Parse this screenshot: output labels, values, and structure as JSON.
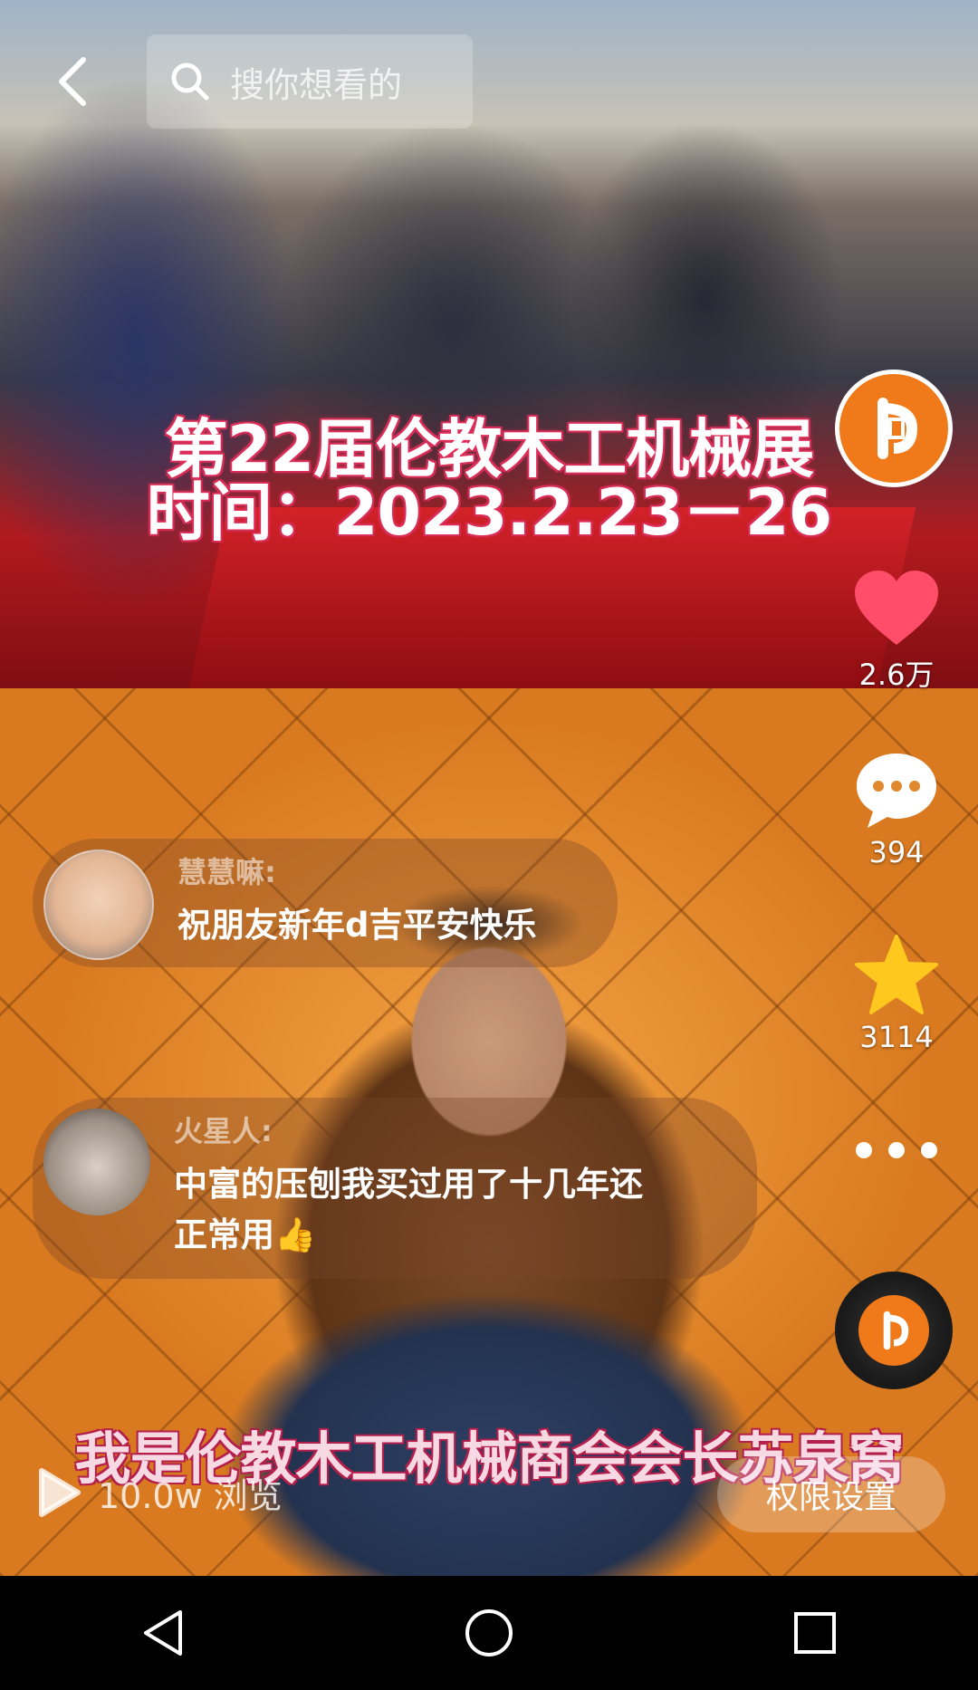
{
  "search": {
    "placeholder": "搜你想看的"
  },
  "top_video": {
    "caption_line1": "第22届伦教木工机械展",
    "caption_line2": "时间：2023.2.23－26"
  },
  "side_actions": {
    "like_count": "2.6万",
    "comment_count": "394",
    "favorite_count": "3114"
  },
  "comments": [
    {
      "user": "慧慧嘛:",
      "text": "祝朋友新年d吉平安快乐"
    },
    {
      "user": "火星人:",
      "text_line1": "中富的压刨我买过用了十几年还",
      "text_line2": "正常用👍"
    }
  ],
  "bottom_video": {
    "caption": "我是伦教木工机械商会会长苏泉窝"
  },
  "footer": {
    "views": "10.0w 浏览",
    "permission_button": "权限设置"
  },
  "colors": {
    "like": "#ff4d6a",
    "favorite": "#ffc81e",
    "brand_orange": "#f07a19"
  },
  "icons": [
    "back-arrow-icon",
    "search-icon",
    "heart-icon",
    "comment-bubble-icon",
    "star-icon",
    "more-dots-icon",
    "play-icon",
    "nav-back-icon",
    "nav-home-icon",
    "nav-recent-icon"
  ]
}
